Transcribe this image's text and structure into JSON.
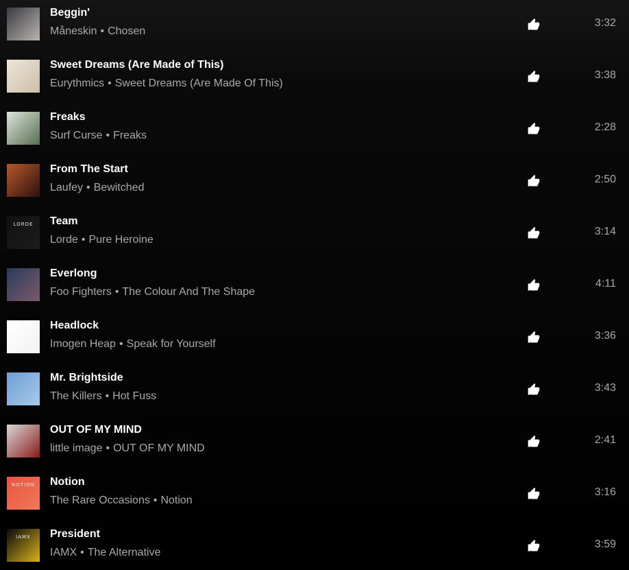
{
  "tracks": [
    {
      "title": "Beggin'",
      "artist": "Måneskin",
      "album": "Chosen",
      "duration": "3:32",
      "art_colors": [
        "#3a3a40",
        "#b9b4b0"
      ],
      "art_label": ""
    },
    {
      "title": "Sweet Dreams (Are Made of This)",
      "artist": "Eurythmics",
      "album": "Sweet Dreams (Are Made Of This)",
      "duration": "3:38",
      "art_colors": [
        "#ece5d8",
        "#cdbfa8"
      ],
      "art_label": ""
    },
    {
      "title": "Freaks",
      "artist": "Surf Curse",
      "album": "Freaks",
      "duration": "2:28",
      "art_colors": [
        "#dfe3dd",
        "#55704f"
      ],
      "art_label": ""
    },
    {
      "title": "From The Start",
      "artist": "Laufey",
      "album": "Bewitched",
      "duration": "2:50",
      "art_colors": [
        "#b9572e",
        "#2b120c"
      ],
      "art_label": ""
    },
    {
      "title": "Team",
      "artist": "Lorde",
      "album": "Pure Heroine",
      "duration": "3:14",
      "art_colors": [
        "#111111",
        "#1c1c1c"
      ],
      "art_label": "LORDE"
    },
    {
      "title": "Everlong",
      "artist": "Foo Fighters",
      "album": "The Colour And The Shape",
      "duration": "4:11",
      "art_colors": [
        "#2b3a5c",
        "#7a5a6a"
      ],
      "art_label": ""
    },
    {
      "title": "Headlock",
      "artist": "Imogen Heap",
      "album": "Speak for Yourself",
      "duration": "3:36",
      "art_colors": [
        "#ffffff",
        "#f2f2f2"
      ],
      "art_label": ""
    },
    {
      "title": "Mr. Brightside",
      "artist": "The Killers",
      "album": "Hot Fuss",
      "duration": "3:43",
      "art_colors": [
        "#6f9fd6",
        "#a9c9ea"
      ],
      "art_label": ""
    },
    {
      "title": "OUT OF MY MIND",
      "artist": "little image",
      "album": "OUT OF MY MIND",
      "duration": "2:41",
      "art_colors": [
        "#d9d9d9",
        "#8a1a1a"
      ],
      "art_label": ""
    },
    {
      "title": "Notion",
      "artist": "The Rare Occasions",
      "album": "Notion",
      "duration": "3:16",
      "art_colors": [
        "#e8533f",
        "#f07a5a"
      ],
      "art_label": "NOTION"
    },
    {
      "title": "President",
      "artist": "IAMX",
      "album": "The Alternative",
      "duration": "3:59",
      "art_colors": [
        "#0a0a0a",
        "#d9b21a"
      ],
      "art_label": "IAMX"
    }
  ],
  "separator": "•",
  "like_icon": "thumb-up-icon",
  "colors": {
    "title": "#ffffff",
    "subtitle": "#a9a9a9",
    "background": "#000000"
  }
}
